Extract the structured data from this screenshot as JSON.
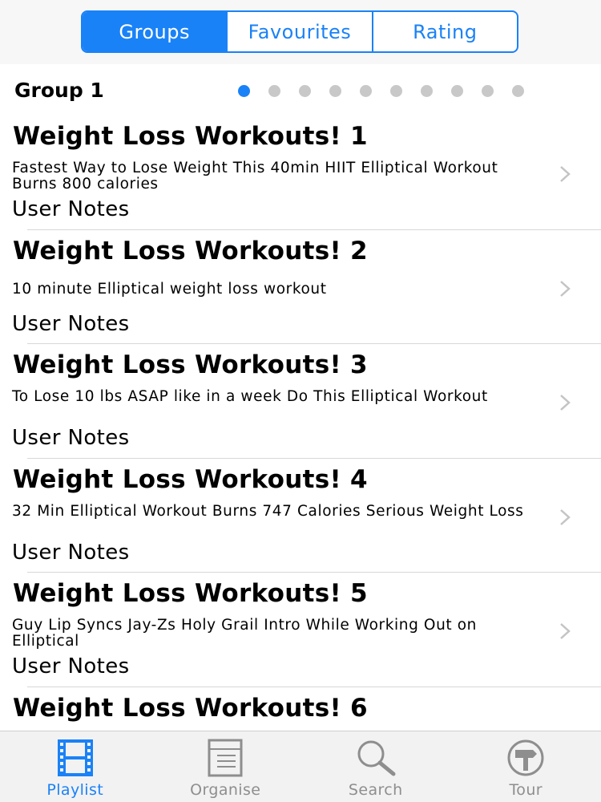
{
  "segments": [
    {
      "label": "Groups",
      "active": true
    },
    {
      "label": "Favourites",
      "active": false
    },
    {
      "label": "Rating",
      "active": false
    }
  ],
  "group": {
    "title": "Group 1",
    "page_count": 10,
    "current_page": 1
  },
  "rows": [
    {
      "title": "Weight Loss Workouts! 1",
      "desc": "Fastest Way to Lose Weight  This 40min HIIT Elliptical Workout Burns 800 calories",
      "notes": "User Notes"
    },
    {
      "title": "Weight Loss Workouts! 2",
      "desc": "10 minute Elliptical weight loss workout",
      "notes": "User Notes"
    },
    {
      "title": "Weight Loss Workouts! 3",
      "desc": "To Lose 10 lbs ASAP like in a week  Do This Elliptical Workout",
      "notes": "User Notes"
    },
    {
      "title": "Weight Loss Workouts! 4",
      "desc": "32 Min Elliptical Workout Burns 747 Calories Serious Weight Loss",
      "notes": "User Notes"
    },
    {
      "title": "Weight Loss Workouts! 5",
      "desc": "Guy Lip Syncs Jay-Zs Holy Grail Intro While Working Out on Elliptical",
      "notes": "User Notes"
    },
    {
      "title": "Weight Loss Workouts! 6",
      "desc": "",
      "notes": ""
    }
  ],
  "tabs": [
    {
      "label": "Playlist",
      "icon": "film-strip-icon",
      "active": true
    },
    {
      "label": "Organise",
      "icon": "list-document-icon",
      "active": false
    },
    {
      "label": "Search",
      "icon": "magnifier-icon",
      "active": false
    },
    {
      "label": "Tour",
      "icon": "signpost-icon",
      "active": false
    }
  ],
  "colors": {
    "accent": "#1a82f7",
    "inactive_tab": "#8e8e8e",
    "dot_inactive": "#c8c8c8"
  }
}
